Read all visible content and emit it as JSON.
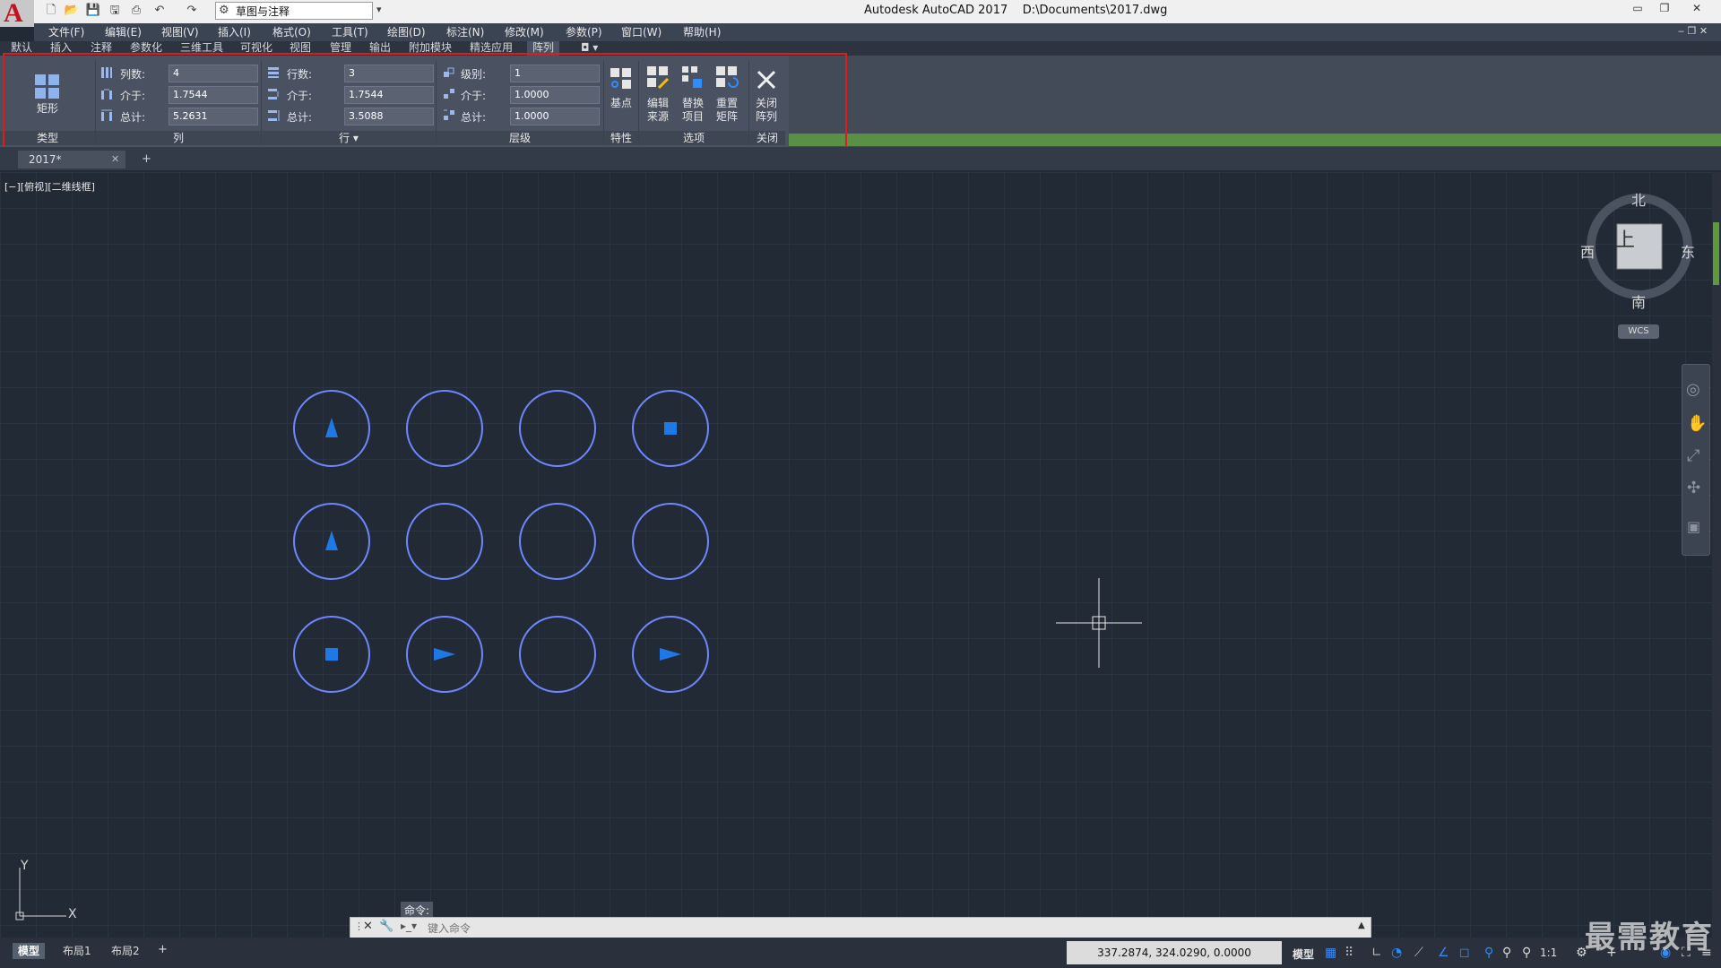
{
  "app": {
    "title": "Autodesk AutoCAD 2017",
    "file_path": "D:\\Documents\\2017.dwg",
    "logo": "A",
    "workspace": "草图与注释"
  },
  "menu": [
    "文件(F)",
    "编辑(E)",
    "视图(V)",
    "插入(I)",
    "格式(O)",
    "工具(T)",
    "绘图(D)",
    "标注(N)",
    "修改(M)",
    "参数(P)",
    "窗口(W)",
    "帮助(H)"
  ],
  "ribbon_tabs": [
    "默认",
    "插入",
    "注释",
    "参数化",
    "三维工具",
    "可视化",
    "视图",
    "管理",
    "输出",
    "附加模块",
    "精选应用",
    "阵列"
  ],
  "ribbon": {
    "type_group": {
      "button": "矩形",
      "label": "类型"
    },
    "columns": {
      "count_label": "列数:",
      "count": "4",
      "between_label": "介于:",
      "between": "1.7544",
      "total_label": "总计:",
      "total": "5.2631",
      "group": "列"
    },
    "rows": {
      "count_label": "行数:",
      "count": "3",
      "between_label": "介于:",
      "between": "1.7544",
      "total_label": "总计:",
      "total": "3.5088",
      "group": "行 ▾"
    },
    "levels": {
      "count_label": "级别:",
      "count": "1",
      "between_label": "介于:",
      "between": "1.0000",
      "total_label": "总计:",
      "total": "1.0000",
      "group": "层级"
    },
    "properties": {
      "base_point": "基点",
      "group": "特性"
    },
    "options": {
      "edit_source": [
        "编辑",
        "来源"
      ],
      "replace_item": [
        "替换",
        "项目"
      ],
      "reset_array": [
        "重置",
        "矩阵"
      ],
      "group": "选项"
    },
    "close": {
      "close_array": [
        "关闭",
        "阵列"
      ],
      "group": "关闭"
    }
  },
  "document_tab": "2017*",
  "viewport_label": "[−][俯视][二维线框]",
  "viewcube": {
    "north": "北",
    "south": "南",
    "east": "东",
    "west": "西",
    "face": "上",
    "wcs": "WCS"
  },
  "ucs": {
    "x": "X",
    "y": "Y"
  },
  "array_cells": [
    {
      "row": 1,
      "col": 1,
      "symbol": "triangle-up"
    },
    {
      "row": 1,
      "col": 2,
      "symbol": "none"
    },
    {
      "row": 1,
      "col": 3,
      "symbol": "none"
    },
    {
      "row": 1,
      "col": 4,
      "symbol": "square"
    },
    {
      "row": 2,
      "col": 1,
      "symbol": "triangle-up"
    },
    {
      "row": 2,
      "col": 2,
      "symbol": "none"
    },
    {
      "row": 2,
      "col": 3,
      "symbol": "none"
    },
    {
      "row": 2,
      "col": 4,
      "symbol": "none"
    },
    {
      "row": 3,
      "col": 1,
      "symbol": "square"
    },
    {
      "row": 3,
      "col": 2,
      "symbol": "triangle-right"
    },
    {
      "row": 3,
      "col": 3,
      "symbol": "none"
    },
    {
      "row": 3,
      "col": 4,
      "symbol": "triangle-right"
    }
  ],
  "command": {
    "prompt_label": "命令:",
    "placeholder": "键入命令"
  },
  "layout_tabs": [
    "模型",
    "布局1",
    "布局2"
  ],
  "status": {
    "coordinates": "337.2874, 324.0290, 0.0000",
    "model": "模型",
    "scale": "1:1"
  },
  "watermark": "最需教育",
  "colors": {
    "accent_blue": "#1e78e6",
    "circle_stroke": "#6f86ff",
    "highlight_red": "#e01b1b"
  }
}
